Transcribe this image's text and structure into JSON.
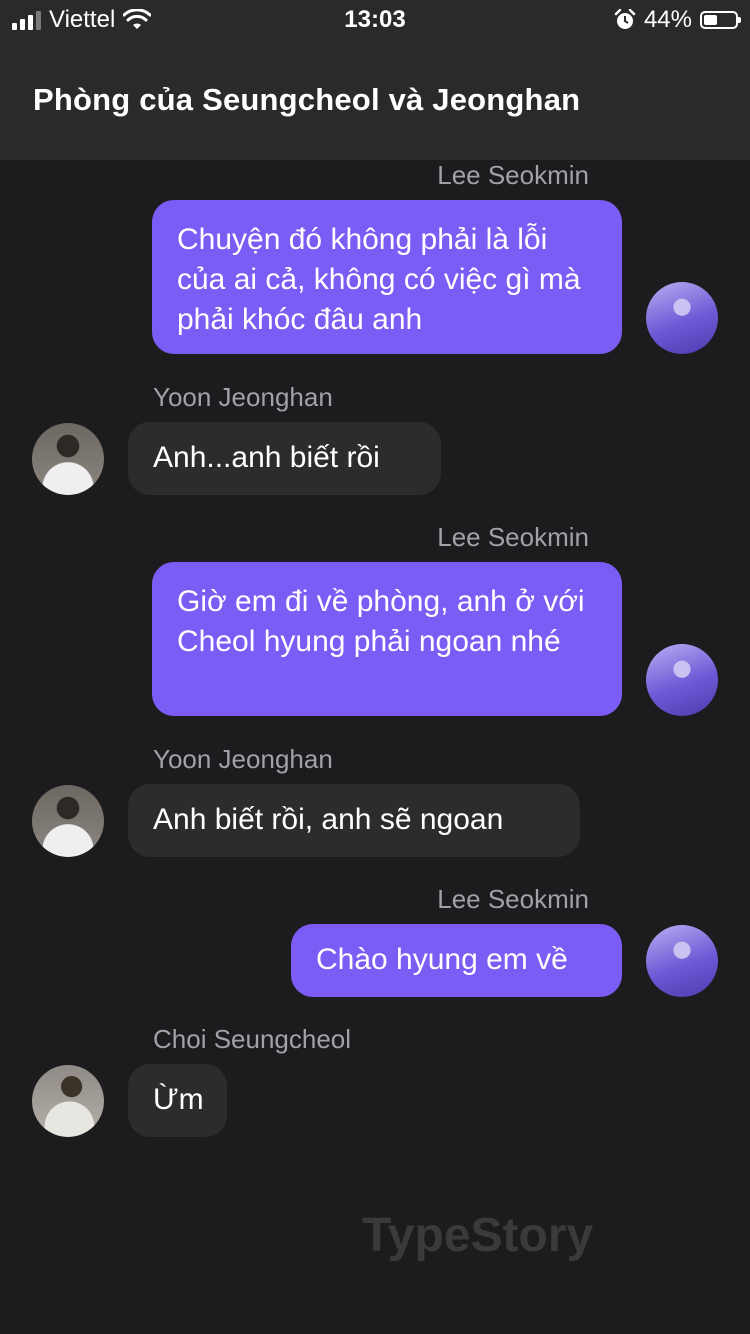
{
  "status_bar": {
    "carrier": "Viettel",
    "time": "13:03",
    "battery_percent": "44%",
    "battery_level": 0.44,
    "signal_bars": 3,
    "icons": [
      "signal-icon",
      "wifi-icon",
      "alarm-icon",
      "battery-icon"
    ]
  },
  "header": {
    "title": "Phòng của Seungcheol và Jeonghan"
  },
  "messages": [
    {
      "sender": "Lee Seokmin",
      "direction": "outgoing",
      "text": "Chuyện đó không phải là lỗi của ai cả, không có việc gì mà phải khóc đâu anh"
    },
    {
      "sender": "Yoon Jeonghan",
      "direction": "incoming",
      "text": "Anh...anh biết rồi"
    },
    {
      "sender": "Lee Seokmin",
      "direction": "outgoing",
      "text": "Giờ em đi về phòng, anh ở với Cheol hyung phải ngoan nhé"
    },
    {
      "sender": "Yoon Jeonghan",
      "direction": "incoming",
      "text": "Anh biết rồi, anh sẽ ngoan"
    },
    {
      "sender": "Lee Seokmin",
      "direction": "outgoing",
      "text": "Chào hyung em về"
    },
    {
      "sender": "Choi Seungcheol",
      "direction": "incoming",
      "text": "Ừm"
    }
  ],
  "watermark": "TypeStory",
  "colors": {
    "background": "#1c1c1e",
    "header": "#2a2a2c",
    "outgoing_bubble": "#7b5cf5",
    "incoming_bubble": "#2c2c2e",
    "sender_name": "#a1a1a6"
  }
}
